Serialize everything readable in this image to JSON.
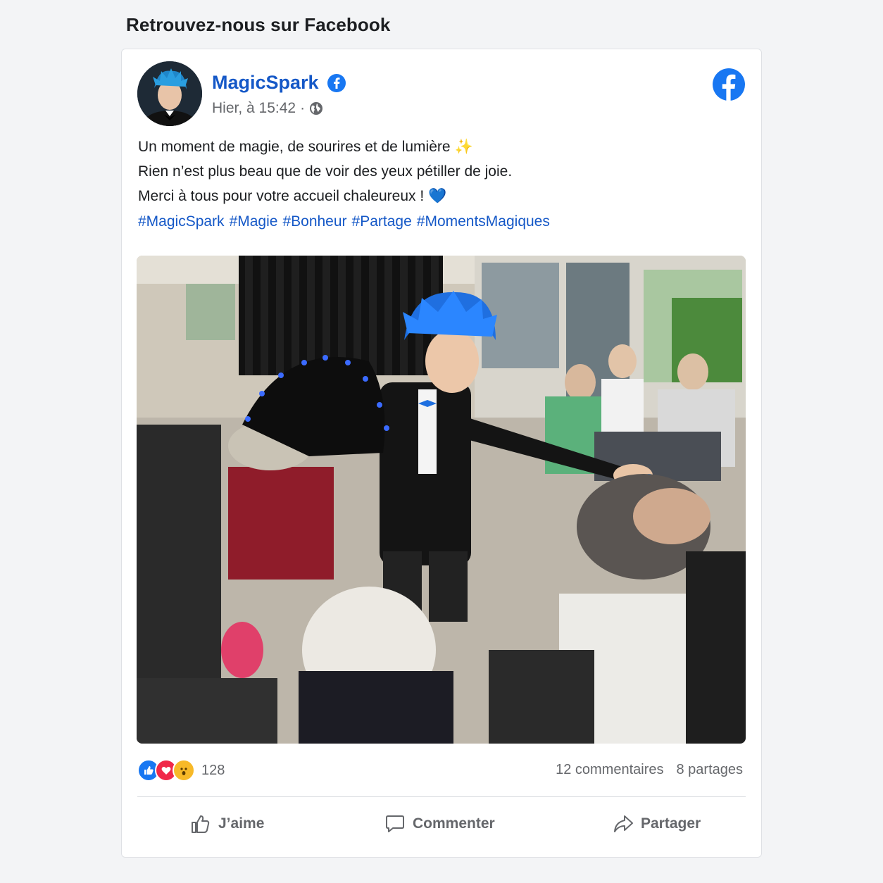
{
  "section_title": "Retrouvez-nous sur Facebook",
  "post": {
    "page_name": "MagicSpark",
    "timestamp": "Hier, à 15:42",
    "separator": "·",
    "audience_icon": "globe-icon",
    "lines": [
      {
        "text": "Un moment de magie, de sourires et de lumière",
        "emoji": "✨"
      },
      {
        "text": "Rien n’est plus beau que de voir des yeux pétiller de joie.",
        "emoji": ""
      },
      {
        "text": "Merci à tous pour votre accueil chaleureux !",
        "emoji": "💙"
      }
    ],
    "hashtags": [
      "#MagicSpark",
      "#Magie",
      "#Bonheur",
      "#Partage",
      "#MomentsMagiques"
    ]
  },
  "engagement": {
    "reaction_icons": [
      "like-icon",
      "love-icon",
      "wow-icon"
    ],
    "reaction_count": "128",
    "comments": "12 commentaires",
    "shares": "8 partages"
  },
  "actions": {
    "like": "J’aime",
    "comment": "Commenter",
    "share": "Partager"
  },
  "colors": {
    "brand_blue": "#1877f2",
    "link_blue": "#1558c7",
    "muted": "#65676b",
    "love_red": "#f02849"
  }
}
